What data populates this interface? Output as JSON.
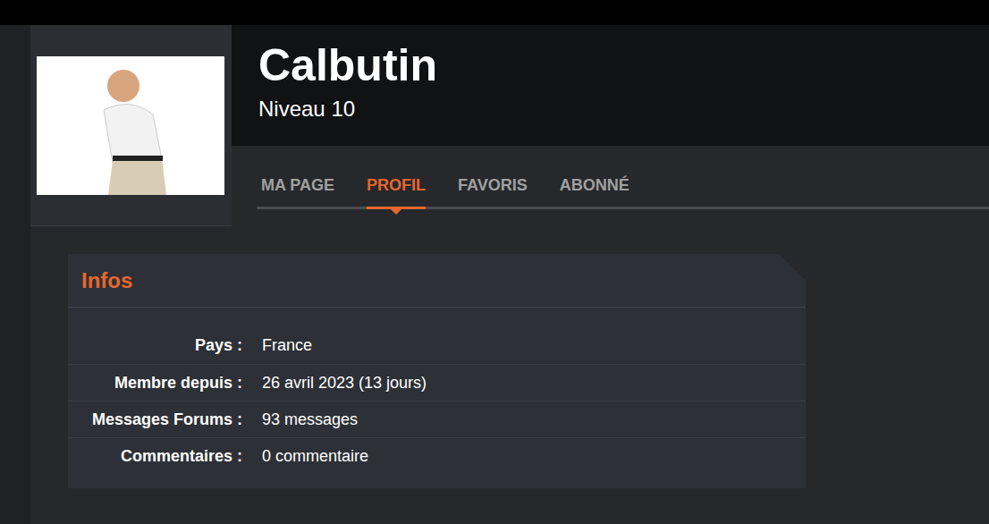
{
  "profile": {
    "name": "Calbutin",
    "level": "Niveau 10"
  },
  "tabs": [
    {
      "label": "MA PAGE",
      "selected": false
    },
    {
      "label": "PROFIL",
      "selected": true
    },
    {
      "label": "FAVORIS",
      "selected": false
    },
    {
      "label": "ABONNÉ",
      "selected": false
    }
  ],
  "infos": {
    "title": "Infos",
    "rows": [
      {
        "label": "Pays :",
        "value": "France"
      },
      {
        "label": "Membre depuis :",
        "value": "26 avril 2023 (13 jours)"
      },
      {
        "label": "Messages Forums :",
        "value": "93 messages"
      },
      {
        "label": "Commentaires :",
        "value": "0 commentaire"
      }
    ]
  }
}
